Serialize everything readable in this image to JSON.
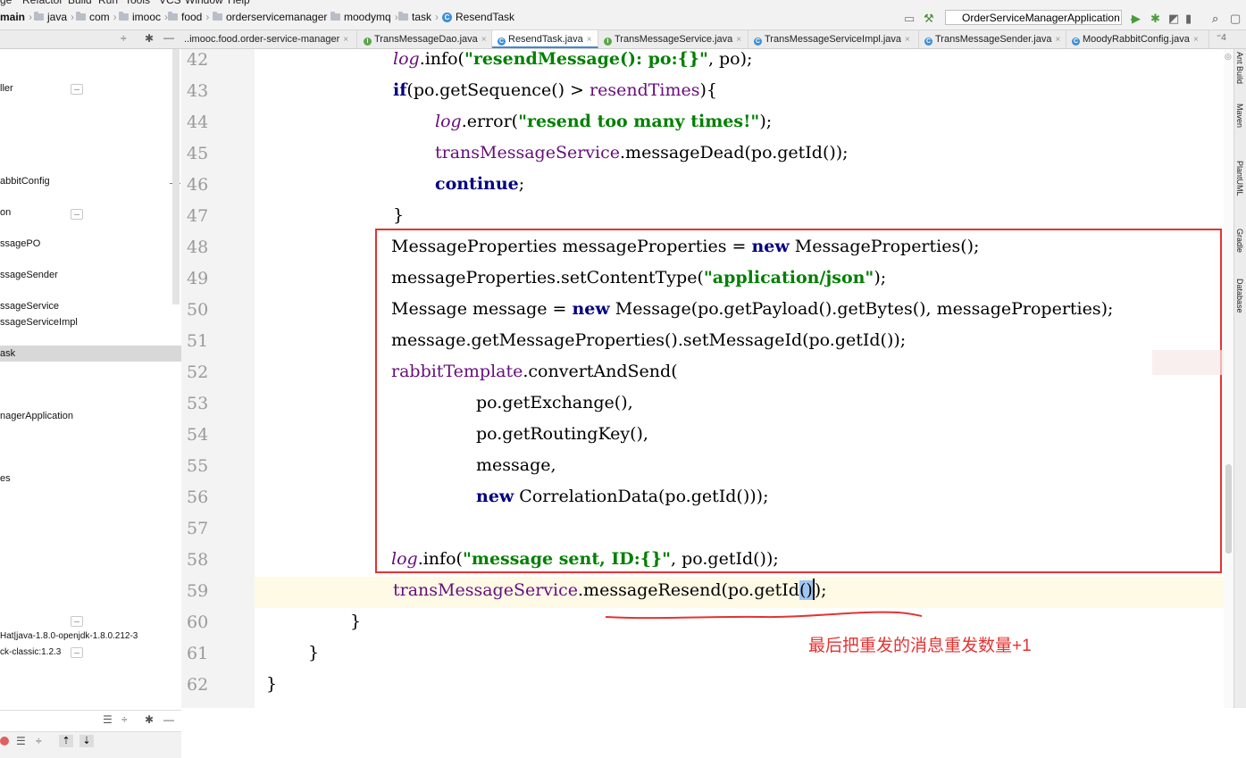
{
  "menu": [
    "ge",
    "Refactor",
    "Build",
    "Run",
    "Tools",
    "VCS",
    "Window",
    "Help"
  ],
  "breadcrumbs": [
    "main",
    "java",
    "com",
    "imooc",
    "food",
    "orderservicemanager",
    "moodymq",
    "task",
    "ResendTask"
  ],
  "run_config": "OrderServiceManagerApplication",
  "tabs": [
    {
      "label": "..imooc.food.order-service-manager",
      "icon": "module-icon"
    },
    {
      "label": "TransMessageDao.java",
      "icon": "interface-icon"
    },
    {
      "label": "ResendTask.java",
      "icon": "class-icon"
    },
    {
      "label": "TransMessageService.java",
      "icon": "interface-icon"
    },
    {
      "label": "TransMessageServiceImpl.java",
      "icon": "class-icon"
    },
    {
      "label": "TransMessageSender.java",
      "icon": "class-icon"
    },
    {
      "label": "MoodyRabbitConfig.java",
      "icon": "class-icon"
    }
  ],
  "project_tree": [
    "ller",
    "abbitConfig",
    "on",
    "ssagePO",
    "ssageSender",
    "ssageService",
    "ssageServiceImpl",
    "ask",
    "nagerApplication",
    "es",
    "Hat|java-1.8.0-openjdk-1.8.0.212-3",
    "ck-classic:1.2.3"
  ],
  "line_numbers": [
    "42",
    "43",
    "44",
    "45",
    "46",
    "47",
    "48",
    "49",
    "50",
    "51",
    "52",
    "53",
    "54",
    "55",
    "56",
    "57",
    "58",
    "59",
    "60",
    "61",
    "62"
  ],
  "code_lines": [
    [
      {
        "t": "log",
        "c": "stc"
      },
      {
        "t": ".info("
      },
      {
        "t": "\"resendMessage(): po:{}\"",
        "c": "str"
      },
      {
        "t": ", po);"
      }
    ],
    [
      {
        "t": "if",
        "c": "kw"
      },
      {
        "t": "(po.getSequence() > "
      },
      {
        "t": "resendTimes",
        "c": "fld"
      },
      {
        "t": "){"
      }
    ],
    [
      {
        "t": "log",
        "c": "stc"
      },
      {
        "t": ".error("
      },
      {
        "t": "\"resend too many times!\"",
        "c": "str"
      },
      {
        "t": ");"
      }
    ],
    [
      {
        "t": "transMessageService",
        "c": "fld"
      },
      {
        "t": ".messageDead(po.getId());"
      }
    ],
    [
      {
        "t": "continue",
        "c": "kw"
      },
      {
        "t": ";"
      }
    ],
    [
      {
        "t": "}"
      }
    ],
    [
      {
        "t": "MessageProperties messageProperties = "
      },
      {
        "t": "new",
        "c": "kw"
      },
      {
        "t": " MessageProperties();"
      }
    ],
    [
      {
        "t": "messageProperties.setContentType("
      },
      {
        "t": "\"application/json\"",
        "c": "str"
      },
      {
        "t": ");"
      }
    ],
    [
      {
        "t": "Message message = "
      },
      {
        "t": "new",
        "c": "kw"
      },
      {
        "t": " Message(po.getPayload().getBytes(), messageProperties);"
      }
    ],
    [
      {
        "t": "message.getMessageProperties().setMessageId(po.getId());"
      }
    ],
    [
      {
        "t": "rabbitTemplate",
        "c": "fld"
      },
      {
        "t": ".convertAndSend("
      }
    ],
    [
      {
        "t": "po.getExchange(),"
      }
    ],
    [
      {
        "t": "po.getRoutingKey(),"
      }
    ],
    [
      {
        "t": "message,"
      }
    ],
    [
      {
        "t": "new",
        "c": "kw"
      },
      {
        "t": " CorrelationData(po.getId()));"
      }
    ],
    [],
    [
      {
        "t": "log",
        "c": "stc"
      },
      {
        "t": ".info("
      },
      {
        "t": "\"message sent, ID:{}\"",
        "c": "str"
      },
      {
        "t": ", po.getId());"
      }
    ],
    [
      {
        "t": "transMessageService",
        "c": "fld"
      },
      {
        "t": ".messageResend(po.getId"
      },
      {
        "t": "()",
        "c": "hl"
      },
      {
        "t": "|",
        "c": "caret"
      },
      {
        "t": ");"
      }
    ],
    [
      {
        "t": "}"
      }
    ],
    [
      {
        "t": "}"
      }
    ],
    [
      {
        "t": "}"
      }
    ]
  ],
  "annotation_note": "最后把重发的消息重发数量+1",
  "right_tools": [
    "Ant Build",
    "Maven",
    "PlantUML",
    "Gradle",
    "Database"
  ],
  "colors": {
    "keyword": "#000080",
    "string": "#008000",
    "field": "#660e7a",
    "annotation": "#e53232"
  }
}
